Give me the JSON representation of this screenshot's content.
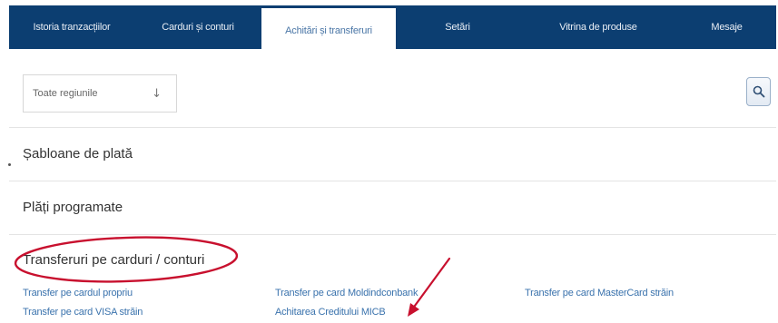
{
  "nav": {
    "tabs": [
      {
        "label": "Istoria tranzacțiilor",
        "active": false
      },
      {
        "label": "Carduri și conturi",
        "active": false
      },
      {
        "label": "Achitări și transferuri",
        "active": true
      },
      {
        "label": "Setări",
        "active": false
      },
      {
        "label": "Vitrina de produse",
        "active": false
      },
      {
        "label": "Mesaje",
        "active": false
      }
    ]
  },
  "filter": {
    "region_selected": "Toate regiunile",
    "dropdown_icon": "arrow-down-icon",
    "search_icon": "search-icon"
  },
  "sections": {
    "payment_templates": "Șabloane de plată",
    "scheduled_payments": "Plăți programate",
    "card_transfers": "Transferuri pe carduri / conturi"
  },
  "links": {
    "own_card": "Transfer pe cardul propriu",
    "visa_foreign": "Transfer pe card VISA străin",
    "moldindconbank": "Transfer pe card Moldindconbank",
    "micb_credit": "Achitarea Creditului MICB",
    "mastercard_foreign": "Transfer pe card MasterCard străin"
  },
  "colors": {
    "nav_background": "#0c3e71",
    "link": "#3b73ad",
    "annotation": "#c8102e"
  }
}
